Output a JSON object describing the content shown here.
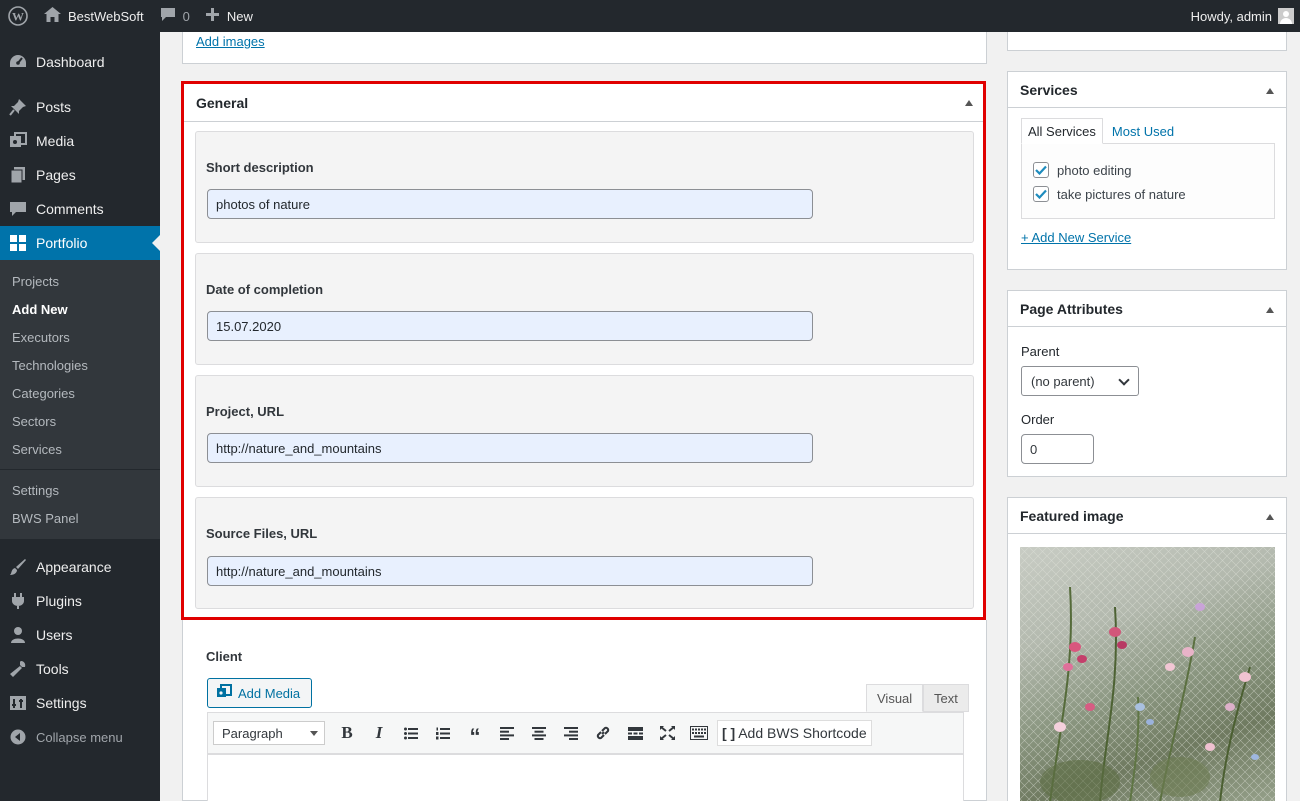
{
  "adminbar": {
    "site_name": "BestWebSoft",
    "comments_count": "0",
    "new_label": "New",
    "howdy": "Howdy, admin"
  },
  "sidebar": {
    "items_top": [
      {
        "label": "Dashboard",
        "icon": "dashboard-icon"
      },
      {
        "label": "Posts",
        "icon": "pin-icon"
      },
      {
        "label": "Media",
        "icon": "media-icon"
      },
      {
        "label": "Pages",
        "icon": "pages-icon"
      },
      {
        "label": "Comments",
        "icon": "comment-icon"
      },
      {
        "label": "Portfolio",
        "icon": "grid-icon"
      }
    ],
    "submenu": [
      "Projects",
      "Add New",
      "Executors",
      "Technologies",
      "Categories",
      "Sectors",
      "Services",
      "Settings",
      "BWS Panel"
    ],
    "items_bottom": [
      {
        "label": "Appearance",
        "icon": "brush-icon"
      },
      {
        "label": "Plugins",
        "icon": "plugin-icon"
      },
      {
        "label": "Users",
        "icon": "users-icon"
      },
      {
        "label": "Tools",
        "icon": "wrench-icon"
      },
      {
        "label": "Settings",
        "icon": "settings-icon"
      }
    ],
    "collapse_label": "Collapse menu"
  },
  "main": {
    "add_images_link": "Add images",
    "general": {
      "title": "General",
      "fields": [
        {
          "label": "Short description",
          "value": "photos of nature"
        },
        {
          "label": "Date of completion",
          "value": "15.07.2020"
        },
        {
          "label": "Project, URL",
          "value": "http://nature_and_mountains"
        },
        {
          "label": "Source Files, URL",
          "value": "http://nature_and_mountains"
        }
      ]
    },
    "client": {
      "label": "Client",
      "add_media": "Add Media",
      "tab_visual": "Visual",
      "tab_text": "Text",
      "format_select": "Paragraph",
      "bws_shortcode": "Add BWS Shortcode"
    }
  },
  "right": {
    "services": {
      "title": "Services",
      "tab_all": "All Services",
      "tab_most_used": "Most Used",
      "items": [
        "photo editing",
        "take pictures of nature"
      ],
      "add_new": "+ Add New Service"
    },
    "attributes": {
      "title": "Page Attributes",
      "parent_label": "Parent",
      "parent_value": "(no parent)",
      "order_label": "Order",
      "order_value": "0"
    },
    "featured": {
      "title": "Featured image"
    }
  },
  "colors": {
    "admin_dark": "#23282d",
    "accent_blue": "#0073aa",
    "highlight_red": "#e00000",
    "autofill_blue": "#e8f0fe"
  }
}
